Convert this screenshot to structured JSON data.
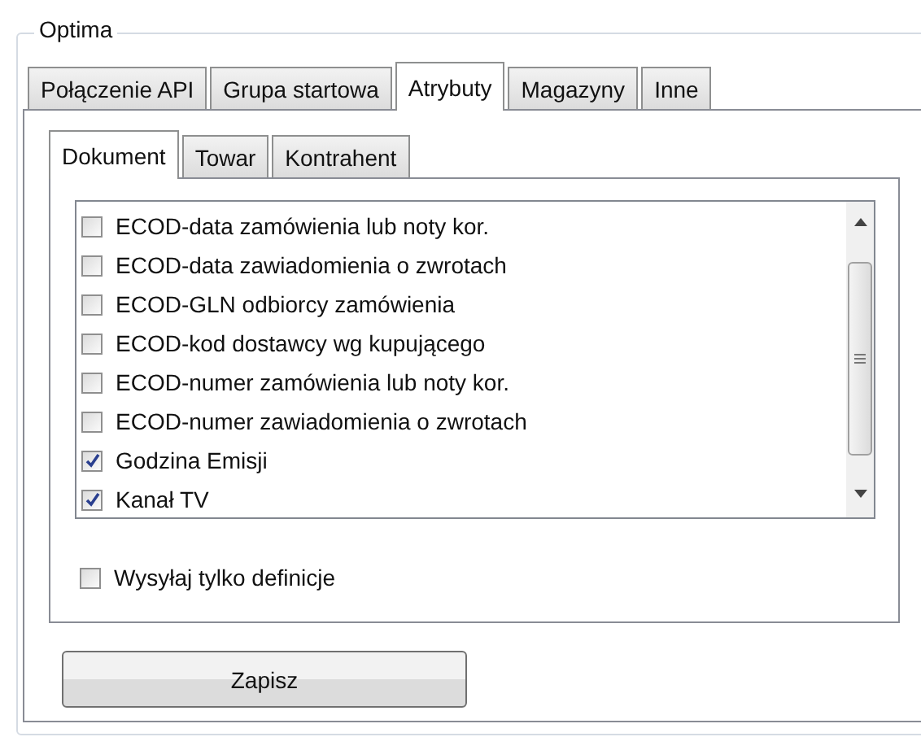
{
  "group": {
    "title": "Optima"
  },
  "tabs": [
    {
      "label": "Połączenie API",
      "selected": false
    },
    {
      "label": "Grupa startowa",
      "selected": false
    },
    {
      "label": "Atrybuty",
      "selected": true
    },
    {
      "label": "Magazyny",
      "selected": false
    },
    {
      "label": "Inne",
      "selected": false
    }
  ],
  "subtabs": [
    {
      "label": "Dokument",
      "selected": true
    },
    {
      "label": "Towar",
      "selected": false
    },
    {
      "label": "Kontrahent",
      "selected": false
    }
  ],
  "attributes": [
    {
      "label": "ECOD-data zamówienia lub noty kor.",
      "checked": false
    },
    {
      "label": "ECOD-data zawiadomienia o zwrotach",
      "checked": false
    },
    {
      "label": "ECOD-GLN odbiorcy zamówienia",
      "checked": false
    },
    {
      "label": "ECOD-kod dostawcy wg kupującego",
      "checked": false
    },
    {
      "label": "ECOD-numer zamówienia lub noty kor.",
      "checked": false
    },
    {
      "label": "ECOD-numer zawiadomienia o zwrotach",
      "checked": false
    },
    {
      "label": "Godzina Emisji",
      "checked": true
    },
    {
      "label": "Kanał TV",
      "checked": true
    }
  ],
  "definitions_only": {
    "label": "Wysyłaj tylko definicje",
    "checked": false
  },
  "save_button": "Zapisz"
}
